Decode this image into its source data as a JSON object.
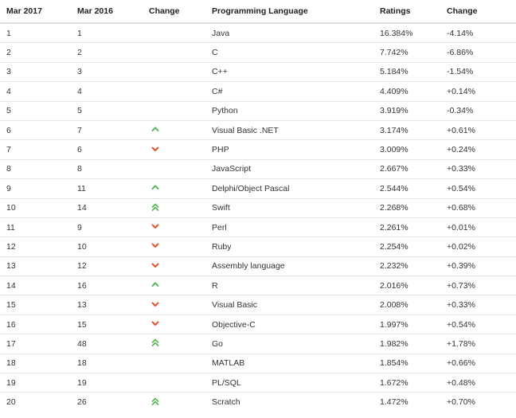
{
  "colors": {
    "up": "#5cb85c",
    "down": "#e8522b",
    "border": "#e4e4e4"
  },
  "table": {
    "headers": {
      "rank_2017": "Mar 2017",
      "rank_2016": "Mar 2016",
      "change": "Change",
      "language": "Programming Language",
      "ratings": "Ratings",
      "ratings_change": "Change"
    },
    "rows": [
      {
        "rank_2017": "1",
        "rank_2016": "1",
        "trend": "none",
        "language": "Java",
        "ratings": "16.384%",
        "change": "-4.14%"
      },
      {
        "rank_2017": "2",
        "rank_2016": "2",
        "trend": "none",
        "language": "C",
        "ratings": "7.742%",
        "change": "-6.86%"
      },
      {
        "rank_2017": "3",
        "rank_2016": "3",
        "trend": "none",
        "language": "C++",
        "ratings": "5.184%",
        "change": "-1.54%"
      },
      {
        "rank_2017": "4",
        "rank_2016": "4",
        "trend": "none",
        "language": "C#",
        "ratings": "4.409%",
        "change": "+0.14%"
      },
      {
        "rank_2017": "5",
        "rank_2016": "5",
        "trend": "none",
        "language": "Python",
        "ratings": "3.919%",
        "change": "-0.34%"
      },
      {
        "rank_2017": "6",
        "rank_2016": "7",
        "trend": "up",
        "language": "Visual Basic .NET",
        "ratings": "3.174%",
        "change": "+0.61%"
      },
      {
        "rank_2017": "7",
        "rank_2016": "6",
        "trend": "down",
        "language": "PHP",
        "ratings": "3.009%",
        "change": "+0.24%"
      },
      {
        "rank_2017": "8",
        "rank_2016": "8",
        "trend": "none",
        "language": "JavaScript",
        "ratings": "2.667%",
        "change": "+0.33%"
      },
      {
        "rank_2017": "9",
        "rank_2016": "11",
        "trend": "up",
        "language": "Delphi/Object Pascal",
        "ratings": "2.544%",
        "change": "+0.54%"
      },
      {
        "rank_2017": "10",
        "rank_2016": "14",
        "trend": "double-up",
        "language": "Swift",
        "ratings": "2.268%",
        "change": "+0.68%"
      },
      {
        "rank_2017": "11",
        "rank_2016": "9",
        "trend": "down",
        "language": "Perl",
        "ratings": "2.261%",
        "change": "+0.01%"
      },
      {
        "rank_2017": "12",
        "rank_2016": "10",
        "trend": "down",
        "language": "Ruby",
        "ratings": "2.254%",
        "change": "+0.02%"
      },
      {
        "rank_2017": "13",
        "rank_2016": "12",
        "trend": "down",
        "language": "Assembly language",
        "ratings": "2.232%",
        "change": "+0.39%"
      },
      {
        "rank_2017": "14",
        "rank_2016": "16",
        "trend": "up",
        "language": "R",
        "ratings": "2.016%",
        "change": "+0.73%"
      },
      {
        "rank_2017": "15",
        "rank_2016": "13",
        "trend": "down",
        "language": "Visual Basic",
        "ratings": "2.008%",
        "change": "+0.33%"
      },
      {
        "rank_2017": "16",
        "rank_2016": "15",
        "trend": "down",
        "language": "Objective-C",
        "ratings": "1.997%",
        "change": "+0.54%"
      },
      {
        "rank_2017": "17",
        "rank_2016": "48",
        "trend": "double-up",
        "language": "Go",
        "ratings": "1.982%",
        "change": "+1.78%"
      },
      {
        "rank_2017": "18",
        "rank_2016": "18",
        "trend": "none",
        "language": "MATLAB",
        "ratings": "1.854%",
        "change": "+0.66%"
      },
      {
        "rank_2017": "19",
        "rank_2016": "19",
        "trend": "none",
        "language": "PL/SQL",
        "ratings": "1.672%",
        "change": "+0.48%"
      },
      {
        "rank_2017": "20",
        "rank_2016": "26",
        "trend": "double-up",
        "language": "Scratch",
        "ratings": "1.472%",
        "change": "+0.70%"
      }
    ]
  }
}
